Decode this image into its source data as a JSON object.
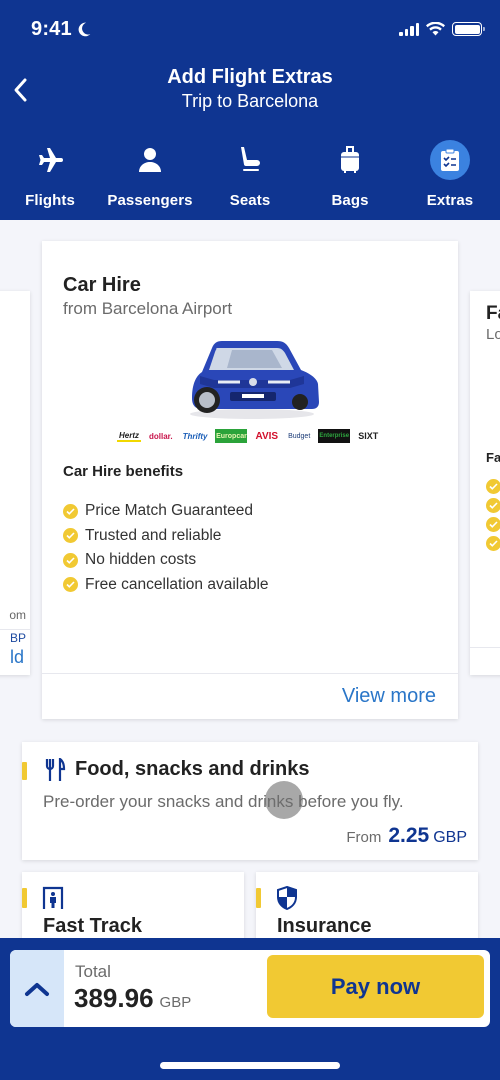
{
  "status_bar": {
    "time": "9:41"
  },
  "header": {
    "title": "Add Flight Extras",
    "subtitle": "Trip to Barcelona"
  },
  "steps": [
    {
      "label": "Flights",
      "icon": "airplane-icon",
      "active": false
    },
    {
      "label": "Passengers",
      "icon": "person-icon",
      "active": false
    },
    {
      "label": "Seats",
      "icon": "seat-icon",
      "active": false
    },
    {
      "label": "Bags",
      "icon": "luggage-icon",
      "active": false
    },
    {
      "label": "Extras",
      "icon": "clipboard-checklist-icon",
      "active": true
    }
  ],
  "carousel": {
    "prev_card": {
      "from_partial": "om",
      "gbp_partial": "BP",
      "action_partial": "ld"
    },
    "main_card": {
      "title": "Car Hire",
      "subtitle": "from Barcelona Airport",
      "partners": [
        "Hertz",
        "dollar.",
        "Thrifty",
        "Europcar",
        "AVIS",
        "Budget",
        "Enterprise",
        "SIXT"
      ],
      "benefits_title": "Car Hire benefits",
      "benefits": [
        "Price Match Guaranteed",
        "Trusted and reliable",
        "No hidden costs",
        "Free cancellation available"
      ],
      "view_more": "View more"
    },
    "next_card": {
      "title_partial": "Fa",
      "subtitle_partial": "Lo",
      "benefits_title_partial": "Fa"
    }
  },
  "food": {
    "title": "Food, snacks and drinks",
    "description": "Pre-order your snacks and drinks before you fly.",
    "from_label": "From",
    "price": "2.25",
    "currency": "GBP"
  },
  "fast_track": {
    "title": "Fast Track"
  },
  "insurance": {
    "title": "Insurance"
  },
  "footer": {
    "total_label": "Total",
    "total_value": "389.96",
    "currency": "GBP",
    "pay_label": "Pay now"
  },
  "colors": {
    "brand_blue": "#0f3591",
    "accent_yellow": "#f1c933",
    "link_blue": "#2a76c8",
    "active_step": "#3b82e0"
  }
}
